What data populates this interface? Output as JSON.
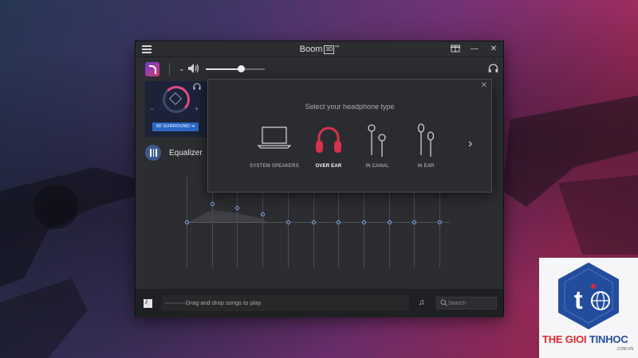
{
  "window": {
    "title": "Boom",
    "title_mark": "3D",
    "title_sup": "™"
  },
  "toolbar": {
    "volume_percent": 60
  },
  "surround": {
    "button_label": "3D SURROUND ➔",
    "minus": "−",
    "plus": "+"
  },
  "equalizer": {
    "label": "Equalizer",
    "bands": [
      0.5,
      0.3,
      0.35,
      0.42,
      0.5,
      0.5,
      0.5,
      0.5,
      0.5,
      0.5,
      0.5
    ]
  },
  "bottom": {
    "drop_text": "Drag and drop songs to play",
    "search_placeholder": "Search"
  },
  "popup": {
    "title": "Select your headphone type",
    "close": "✕",
    "options": [
      {
        "label": "SYSTEM SPEAKERS",
        "icon": "laptop-icon",
        "selected": false
      },
      {
        "label": "OVER EAR",
        "icon": "over-ear-headphone-icon",
        "selected": true
      },
      {
        "label": "IN CANAL",
        "icon": "in-canal-earphone-icon",
        "selected": false
      },
      {
        "label": "IN EAR",
        "icon": "in-ear-earphone-icon",
        "selected": false
      }
    ],
    "next": "›"
  },
  "watermark": {
    "brand_part1": "THE GIOI ",
    "brand_part2": "TINHOC",
    "sub": ".COM.VN"
  },
  "colors": {
    "accent_pink": "#d8324f",
    "surround_blue": "#2b67c8",
    "eq_knob": "#8fb3ea"
  }
}
